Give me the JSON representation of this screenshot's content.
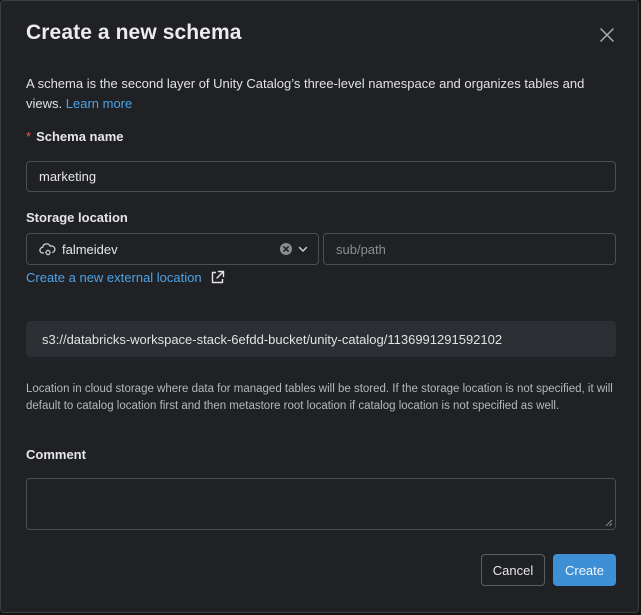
{
  "dialog": {
    "title": "Create a new schema",
    "description": "A schema is the second layer of Unity Catalog’s three-level namespace and organizes tables and views.",
    "learn_more": "Learn more"
  },
  "schema_name": {
    "required_mark": "*",
    "label": "Schema name",
    "value": "marketing"
  },
  "storage": {
    "label": "Storage location",
    "selected": "falmeidev",
    "subpath_placeholder": "sub/path",
    "create_external_link": "Create a new external location",
    "resolved_path": "s3://databricks-workspace-stack-6efdd-bucket/unity-catalog/1136991291592102",
    "help_text": "Location in cloud storage where data for managed tables will be stored. If the storage location is not specified, it will default to catalog location first and then metastore root location if catalog location is not specified as well."
  },
  "comment": {
    "label": "Comment",
    "value": ""
  },
  "buttons": {
    "cancel": "Cancel",
    "create": "Create"
  },
  "icons": {
    "close": "close-icon",
    "cloud": "cloud-storage-icon",
    "clear": "clear-circle-icon",
    "chevron": "chevron-down-icon",
    "external": "external-link-icon"
  },
  "colors": {
    "accent": "#3d8fd6",
    "link": "#4da3e8",
    "required": "#e25c5c",
    "background": "#1f2124"
  }
}
